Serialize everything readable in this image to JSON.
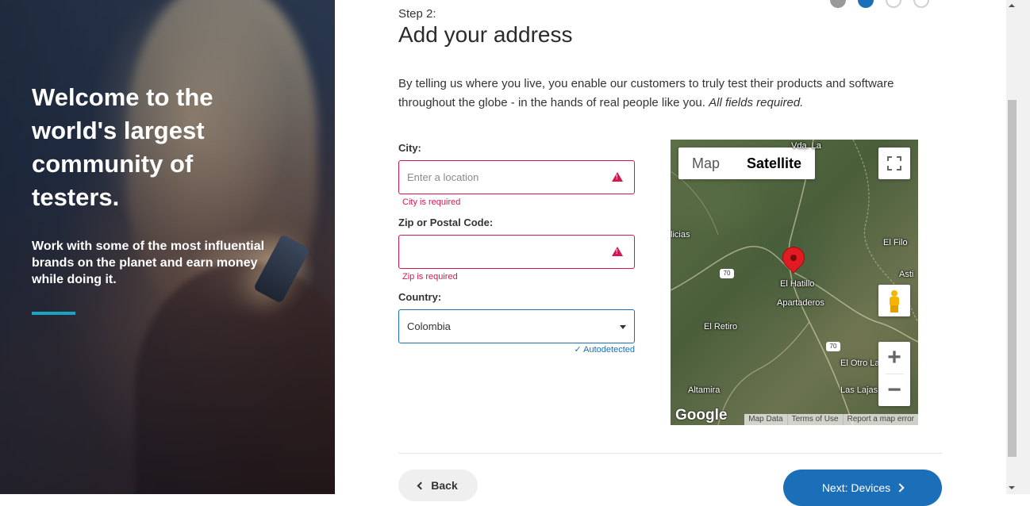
{
  "hero": {
    "title": "Welcome to the world's largest community of testers.",
    "subtitle": "Work with some of the most influential brands on the planet and earn money while doing it."
  },
  "progress": {
    "current_step": 2,
    "total_steps": 4
  },
  "step_label": "Step 2:",
  "page_title": "Add your address",
  "intro_text": "By telling us where you live, you enable our customers to truly test their products and software throughout the globe - in the hands of real people like you.",
  "intro_emphasis": "All fields required.",
  "form": {
    "city": {
      "label": "City:",
      "placeholder": "Enter a location",
      "value": "",
      "error": "City is required"
    },
    "zip": {
      "label": "Zip or Postal Code:",
      "placeholder": "",
      "value": "",
      "error": "Zip is required"
    },
    "country": {
      "label": "Country:",
      "value": "Colombia",
      "note": "✓ Autodetected"
    }
  },
  "map": {
    "type_options": [
      "Map",
      "Satellite"
    ],
    "selected_type": "Satellite",
    "places": [
      "Vda. La",
      "licias",
      "El Filo",
      "Asti",
      "El Hatillo",
      "Apartaderos",
      "El Retiro",
      "El Otro La",
      "Altamira",
      "Las Lajas"
    ],
    "roads": [
      "70",
      "70"
    ],
    "logo": "Google",
    "footer": [
      "Map Data",
      "Terms of Use",
      "Report a map error"
    ],
    "zoom_in": "+",
    "zoom_out": "−"
  },
  "buttons": {
    "back": "Back",
    "next": "Next: Devices"
  },
  "colors": {
    "accent": "#1a6fb8",
    "error": "#d6164f",
    "hero_line": "#1ba3c6"
  }
}
